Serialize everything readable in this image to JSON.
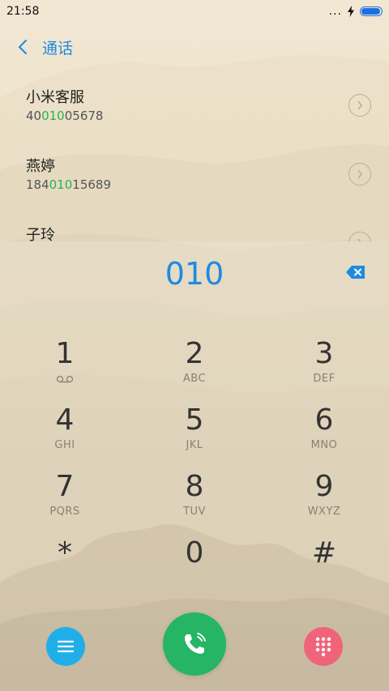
{
  "status": {
    "time": "21:58",
    "more": "...",
    "battery_level": 0.95,
    "battery_color": "#1b6fe0"
  },
  "header": {
    "title": "通话",
    "back_icon": "chevron-left-icon"
  },
  "contacts": [
    {
      "name": "小米客服",
      "number_prefix": "40",
      "number_match": "010",
      "number_suffix": "05678"
    },
    {
      "name": "燕婷",
      "number_prefix": "184",
      "number_match": "010",
      "number_suffix": "15689"
    },
    {
      "name": "子玲",
      "number_prefix": "",
      "number_match": "",
      "number_suffix": ""
    }
  ],
  "dialer": {
    "input": "010",
    "delete_icon": "backspace-icon",
    "keys": [
      {
        "digit": "1",
        "letters": "",
        "icon": "voicemail-icon"
      },
      {
        "digit": "2",
        "letters": "ABC"
      },
      {
        "digit": "3",
        "letters": "DEF"
      },
      {
        "digit": "4",
        "letters": "GHI"
      },
      {
        "digit": "5",
        "letters": "JKL"
      },
      {
        "digit": "6",
        "letters": "MNO"
      },
      {
        "digit": "7",
        "letters": "PQRS"
      },
      {
        "digit": "8",
        "letters": "TUV"
      },
      {
        "digit": "9",
        "letters": "WXYZ"
      },
      {
        "digit": "*",
        "letters": ""
      },
      {
        "digit": "0",
        "letters": ""
      },
      {
        "digit": "#",
        "letters": ""
      }
    ]
  },
  "bottom": {
    "menu_icon": "menu-icon",
    "call_icon": "phone-icon",
    "keypad_icon": "dialpad-icon",
    "colors": {
      "menu": "#20aee9",
      "call": "#25b564",
      "keypad": "#f0647a",
      "accent": "#1e8ae0",
      "match": "#28b34f"
    }
  }
}
